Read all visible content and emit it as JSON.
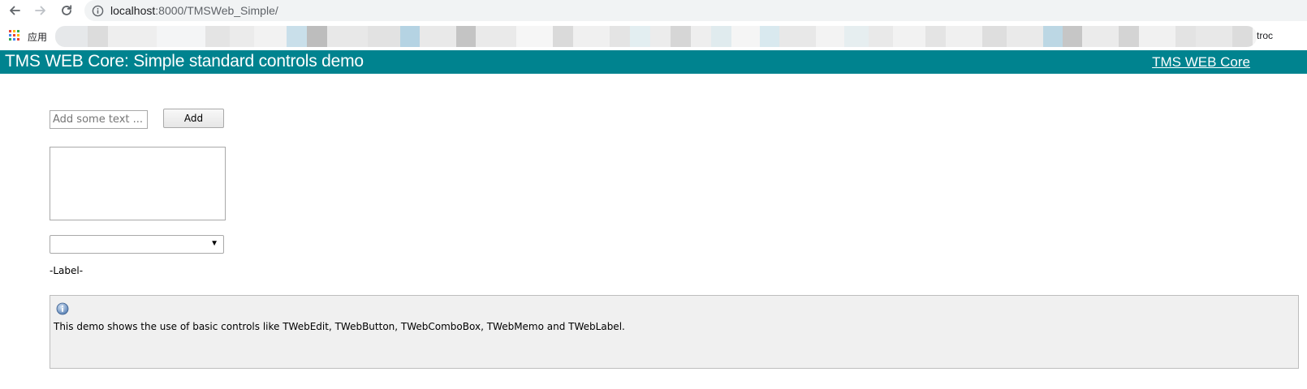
{
  "browser": {
    "url_host": "localhost",
    "url_rest": ":8000/TMSWeb_Simple/",
    "bookmarks": {
      "apps_label": "应用",
      "truncated_label": "troc"
    }
  },
  "header": {
    "title": "TMS WEB Core: Simple standard controls demo",
    "link_label": "TMS WEB Core",
    "background_color": "#00838f"
  },
  "controls": {
    "edit_placeholder": "Add some text ...",
    "edit_value": "",
    "add_button_label": "Add",
    "memo_value": "",
    "combo_selected": "",
    "label_text": "-Label-"
  },
  "info": {
    "text": "This demo shows the use of basic controls like TWebEdit, TWebButton, TWebComboBox, TWebMemo and TWebLabel."
  },
  "icons": {
    "back": "back-arrow-icon",
    "forward": "forward-arrow-icon",
    "reload": "reload-icon",
    "site_info": "info-icon",
    "apps": "apps-grid-icon",
    "combo_arrow": "chevron-down-icon",
    "panel_info": "info-icon"
  }
}
